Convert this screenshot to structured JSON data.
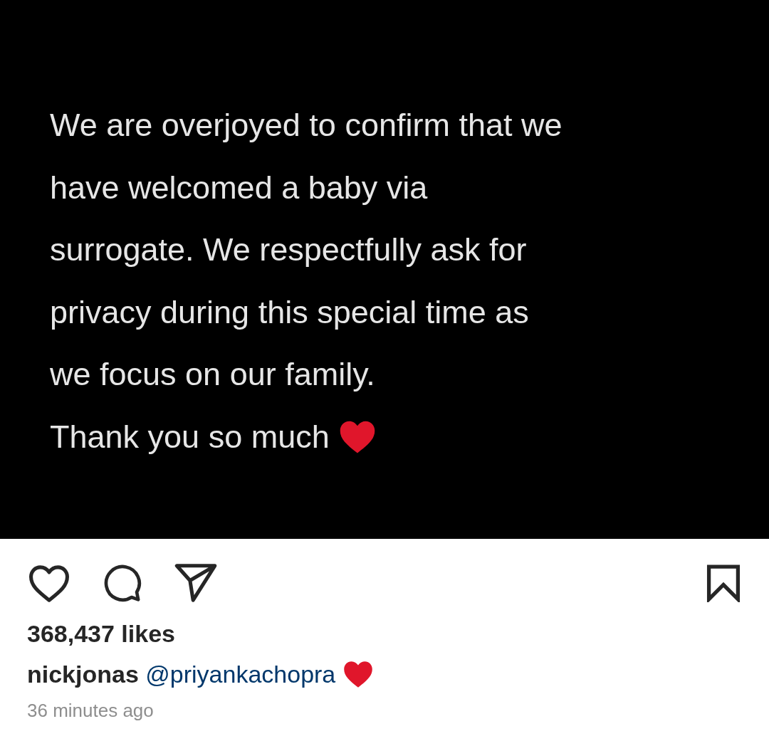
{
  "post_image": {
    "lines": [
      "We are overjoyed to confirm that we",
      "have welcomed a baby via",
      "surrogate. We respectfully ask for",
      "privacy during this special time as",
      "we focus on our family."
    ],
    "closing": "Thank you so much"
  },
  "actions": {
    "liked": false,
    "saved": false
  },
  "likes": "368,437 likes",
  "caption": {
    "username": "nickjonas",
    "mention": "@priyankachopra"
  },
  "time": "36 minutes ago"
}
